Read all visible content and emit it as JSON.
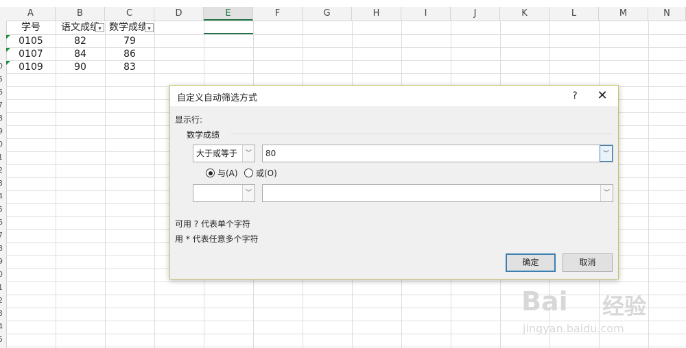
{
  "sheet": {
    "columns": [
      "A",
      "B",
      "C",
      "D",
      "E",
      "F",
      "G",
      "H",
      "I",
      "J",
      "K",
      "L",
      "M",
      "N"
    ],
    "selected_column": "E",
    "headers": {
      "a": "学号",
      "b": "语文成绩",
      "c": "数学成绩"
    },
    "rows": [
      {
        "a": "0105",
        "b": "82",
        "c": "79"
      },
      {
        "a": "0107",
        "b": "84",
        "c": "86"
      },
      {
        "a": "0109",
        "b": "90",
        "c": "83"
      }
    ],
    "row_numbers": [
      "0",
      "5",
      "6",
      "7",
      "8",
      "9",
      "0",
      "1",
      "2",
      "3",
      "4",
      "5",
      "6",
      "7",
      "8",
      "9",
      "0",
      "1",
      "2",
      "3",
      "4",
      "5"
    ]
  },
  "dialog": {
    "title": "自定义自动筛选方式",
    "help_glyph": "?",
    "close_glyph": "✕",
    "show_rows_label": "显示行:",
    "field_label": "数学成绩",
    "condition1": {
      "operator": "大于或等于",
      "value": "80"
    },
    "logic_and": "与(A)",
    "logic_or": "或(O)",
    "logic_selected": "and",
    "condition2": {
      "operator": "",
      "value": ""
    },
    "hint1": "可用 ? 代表单个字符",
    "hint2": "用 * 代表任意多个字符",
    "ok_label": "确定",
    "cancel_label": "取消"
  },
  "watermark": {
    "brand": "Bai",
    "brand_cn": "经验",
    "site": "jingyan.baidu.com"
  },
  "colors": {
    "accent": "#217346",
    "focus": "#3c7fb1"
  }
}
